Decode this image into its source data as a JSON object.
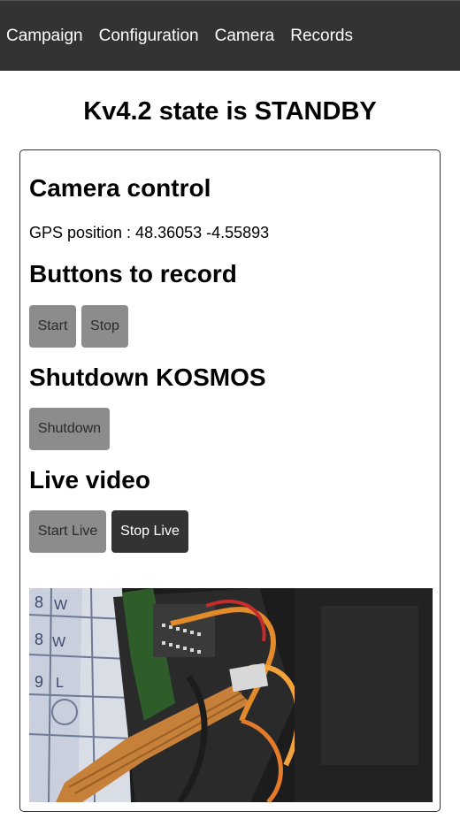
{
  "nav": {
    "items": [
      "Campaign",
      "Configuration",
      "Camera",
      "Records"
    ]
  },
  "status": {
    "title": "Kv4.2 state is STANDBY"
  },
  "camera_control": {
    "heading": "Camera control",
    "gps_label": "GPS position : 48.36053 -4.55893"
  },
  "record": {
    "heading": "Buttons to record",
    "start_label": "Start",
    "stop_label": "Stop"
  },
  "shutdown": {
    "heading": "Shutdown KOSMOS",
    "button_label": "Shutdown"
  },
  "live": {
    "heading": "Live video",
    "start_label": "Start Live",
    "stop_label": "Stop Live"
  },
  "colors": {
    "navbar": "#333333",
    "button_gray": "#8c8c8c",
    "button_dark": "#333333"
  }
}
